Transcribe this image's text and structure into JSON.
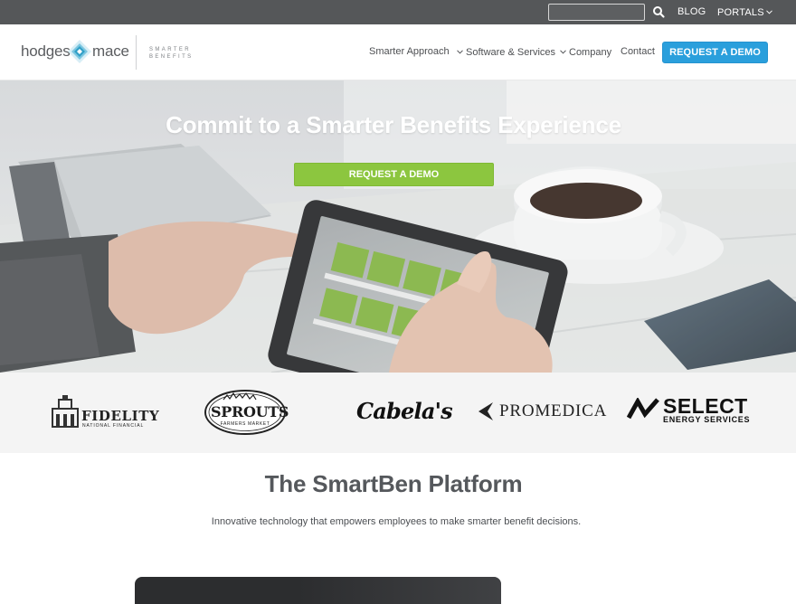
{
  "utility_bar": {
    "search_placeholder": "",
    "search_icon": "search-icon",
    "blog_label": "BLOG",
    "portals_label": "PORTALS"
  },
  "header": {
    "logo_left": "hodges",
    "logo_right": "mace",
    "logo_tagline_line1": "SMARTER",
    "logo_tagline_line2": "BENEFITS",
    "nav": {
      "smarter_approach": "Smarter Approach",
      "software_services": "Software & Services",
      "company": "Company",
      "contact": "Contact"
    },
    "demo_button": "REQUEST A DEMO"
  },
  "hero": {
    "title_pre": "Commit to a ",
    "title_bold": "Smarter Benefits",
    "title_post": " Experience",
    "button": "REQUEST A DEMO"
  },
  "clients": {
    "fidelity": "FIDELITY",
    "fidelity_sub": "NATIONAL FINANCIAL",
    "sprouts": "SPROUTS",
    "sprouts_sub": "FARMERS MARKET",
    "cabelas": "Cabela's",
    "promedica": "ProMedica",
    "select": "SELECT",
    "select_sub": "ENERGY SERVICES"
  },
  "platform": {
    "title_pre": "The ",
    "title_bold": "SmartBen",
    "title_post": " Platform",
    "subtitle": "Innovative technology that empowers employees to make smarter benefit decisions."
  },
  "colors": {
    "utility_bar": "#555759",
    "accent_blue": "#2a9fdc",
    "accent_green": "#8cc63f",
    "logo_teal": "#3fa9c9"
  }
}
